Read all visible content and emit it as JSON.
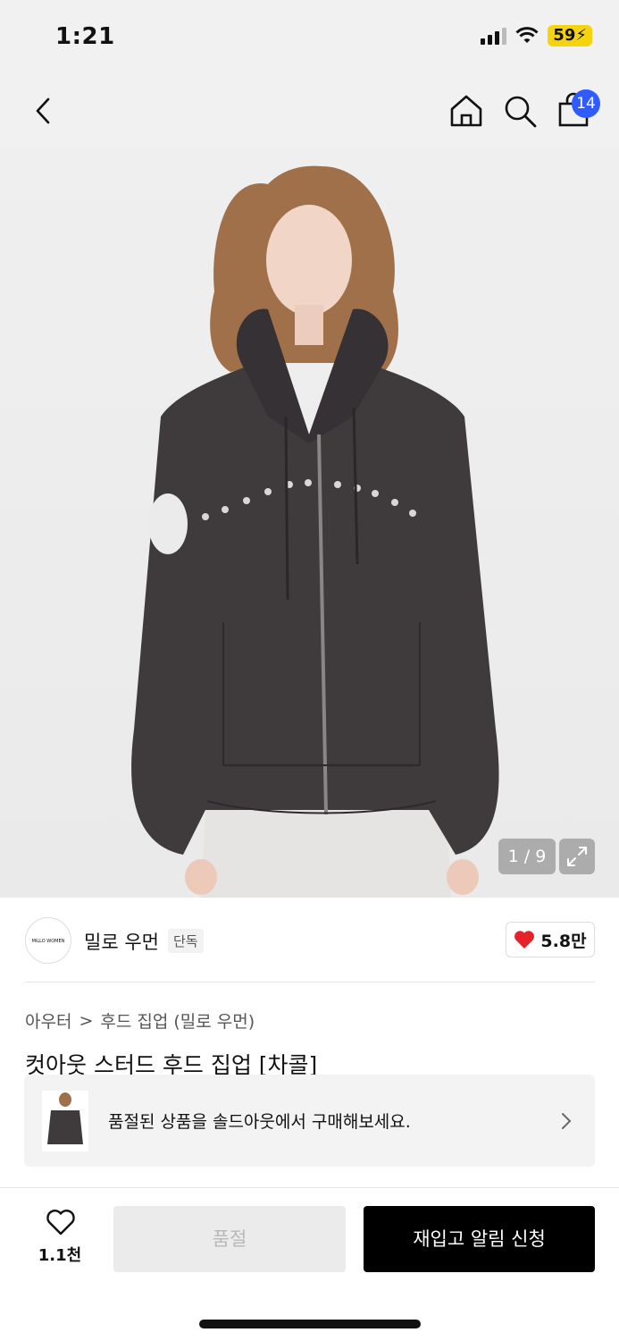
{
  "status_bar": {
    "time": "1:21",
    "battery": "59"
  },
  "nav": {
    "cart_count": "14"
  },
  "gallery": {
    "counter": "1 / 9"
  },
  "brand": {
    "logo_text": "MILLO WOMEN",
    "name": "밀로 우먼",
    "tag": "단독",
    "likes": "5.8만"
  },
  "breadcrumb": {
    "category": "아우터",
    "separator": ">",
    "subcategory": "후드 집업 (밀로 우먼)"
  },
  "product": {
    "title": "컷아웃 스터드 후드 집업 [차콜]"
  },
  "soldout_banner": {
    "text": "품절된 상품을 솔드아웃에서 구매해보세요."
  },
  "bottom_bar": {
    "wish_count": "1.1천",
    "soldout_label": "품절",
    "restock_label": "재입고 알림 신청"
  },
  "colors": {
    "accent_blue": "#2f5bff",
    "heart_red": "#e5222a",
    "battery_yellow": "#f5d40f",
    "primary_black": "#000000"
  }
}
